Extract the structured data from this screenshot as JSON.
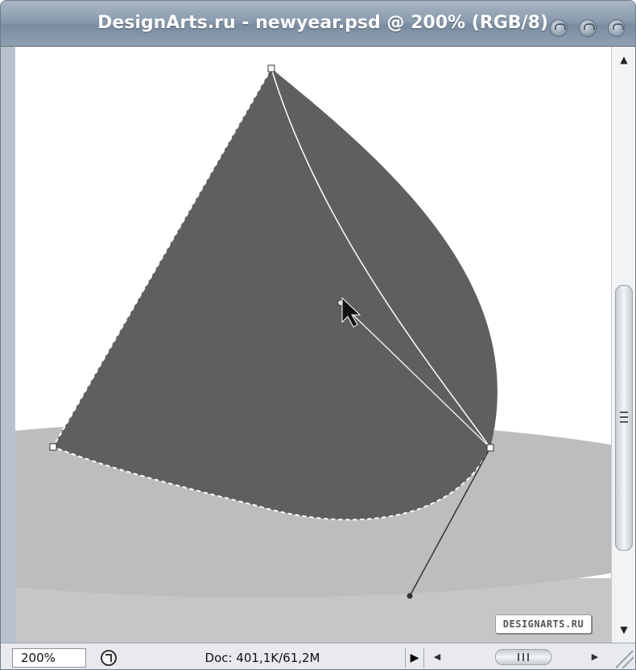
{
  "window": {
    "title": "DesignArts.ru - newyear.psd @ 200% (RGB/8)"
  },
  "canvas": {
    "watermark": "DESIGNARTS.RU"
  },
  "statusbar": {
    "zoom": "200%",
    "doc_info": "Doc: 401,1K/61,2M",
    "menu_arrow": "▶"
  },
  "scrollbars": {
    "up_arrow": "▲",
    "down_arrow": "▼",
    "left_arrow": "◀",
    "right_arrow": "▶"
  },
  "colors": {
    "shape_fill": "#5f5f5f",
    "ellipse_fill": "#bdbdbd",
    "floor_fill": "#c6c6c6",
    "title_text": "#ffffff"
  },
  "icons": [
    "close-icon",
    "minimize-icon",
    "maximize-icon",
    "resize-grip-icon",
    "status-info-icon"
  ]
}
